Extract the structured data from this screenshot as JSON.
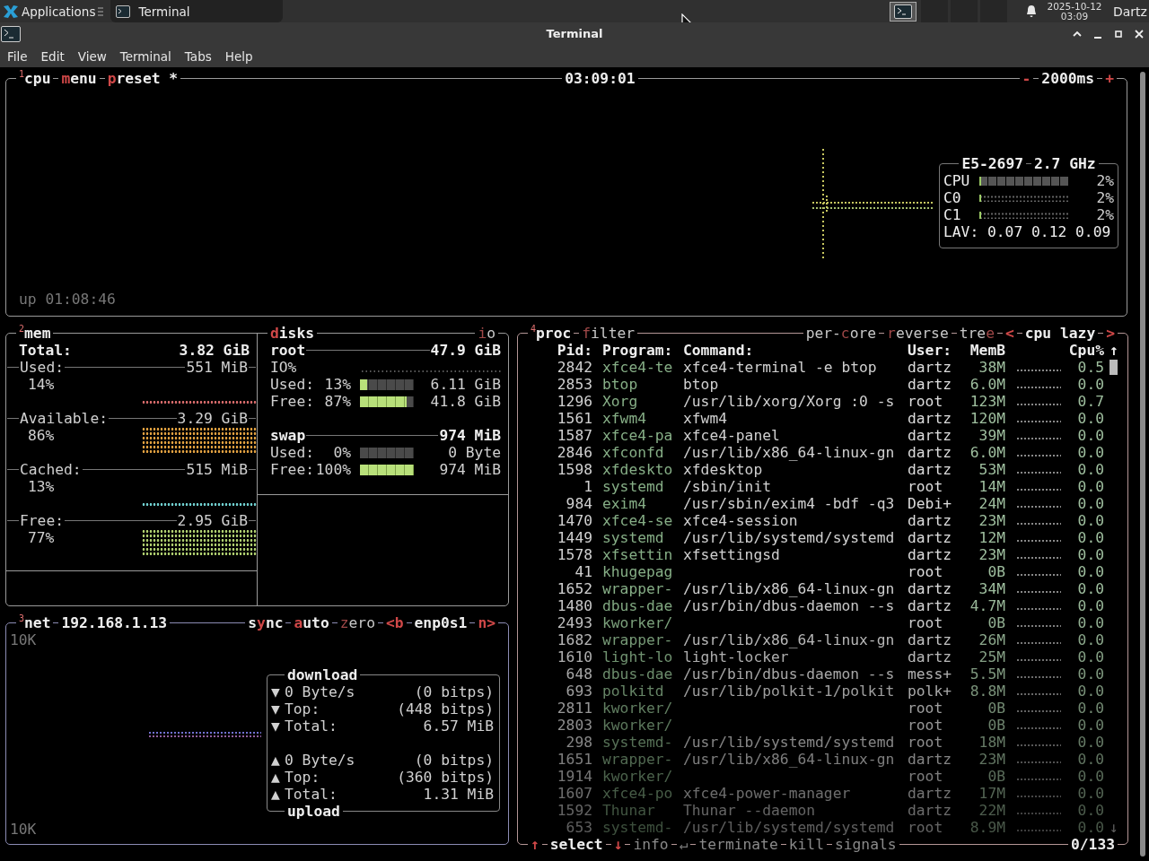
{
  "taskbar": {
    "apps_label": "Applications",
    "window_button": "Terminal",
    "date": "2025-10-12",
    "time": "03:09",
    "user": "Dartz"
  },
  "window": {
    "title": "Terminal"
  },
  "menu": [
    "File",
    "Edit",
    "View",
    "Terminal",
    "Tabs",
    "Help"
  ],
  "cpu": {
    "header": {
      "left": [
        {
          "kind": "title",
          "text": "$^{1}$cpu"
        },
        {
          "kind": "button",
          "key": "m",
          "after": "enu",
          "on": true
        },
        {
          "kind": "button",
          "key": "p",
          "after": "reset *",
          "on": true
        }
      ],
      "center": [
        {
          "kind": "label",
          "text": "03:09:01",
          "on": true
        }
      ],
      "right": [
        {
          "kind": "key",
          "text": "-",
          "on": true
        },
        {
          "kind": "label",
          "text": "2000ms",
          "on": true
        },
        {
          "kind": "key",
          "text": "+",
          "on": true
        }
      ]
    },
    "info": {
      "model": "E5-2697",
      "freq": "2.7 GHz",
      "rows": [
        {
          "label": "CPU",
          "kind": "blocks",
          "level": 0.02,
          "reading": "2%"
        },
        {
          "label": "C0",
          "kind": "dots",
          "level": 0.02,
          "reading": "2%"
        },
        {
          "label": "C1",
          "kind": "dots",
          "level": 0.02,
          "reading": "2%"
        }
      ],
      "load": "LAV: 0.07 0.12 0.09"
    },
    "uptime": "up 01:08:46"
  },
  "mem": {
    "header": {
      "left": [
        {
          "kind": "title",
          "text": "$^{2}$mem"
        }
      ]
    },
    "items": [
      {
        "kind": "total",
        "label": "Total:",
        "value": "3.82 GiB"
      },
      {
        "kind": "line",
        "label": "Used:",
        "value": "551 MiB",
        "percent": "14%",
        "color": "#d46a6a"
      },
      {
        "kind": "block",
        "label": "Available:",
        "value": "3.29 GiB",
        "percent": "86%",
        "color": "#e0a040"
      },
      {
        "kind": "line",
        "label": "Cached:",
        "value": "515 MiB",
        "percent": "13%",
        "color": "#70d0d0"
      },
      {
        "kind": "block",
        "label": "Free:",
        "value": "2.95 GiB",
        "percent": "77%",
        "color": "#b0d070"
      }
    ]
  },
  "disks": {
    "header": {
      "left": [
        {
          "kind": "button",
          "key": "d",
          "after": "isks",
          "on": true
        }
      ],
      "right": [
        {
          "kind": "button",
          "key": "i",
          "after": "o",
          "on": false
        }
      ]
    },
    "items": [
      {
        "name": "root",
        "size": "47.9 GiB",
        "io_label": "IO%",
        "rows": [
          {
            "label": "Used:",
            "percent": "13%",
            "level": 0.13,
            "value": "6.11 GiB"
          },
          {
            "label": "Free:",
            "percent": "87%",
            "level": 0.87,
            "value": "41.8 GiB"
          }
        ]
      },
      {
        "name": "swap",
        "size": "974 MiB",
        "rows": [
          {
            "label": "Used:",
            "percent": "0%",
            "level": 0,
            "value": "0 Byte"
          },
          {
            "label": "Free:",
            "percent": "100%",
            "level": 1,
            "value": "974 MiB"
          }
        ]
      }
    ]
  },
  "net": {
    "header": {
      "left": [
        {
          "kind": "title",
          "text": "$^{3}$net"
        },
        {
          "kind": "label",
          "text": "192.168.1.13",
          "on": true
        }
      ],
      "right": [
        {
          "kind": "button",
          "before": "s",
          "key": "y",
          "after": "nc",
          "on": true
        },
        {
          "kind": "button",
          "key": "a",
          "after": "uto",
          "on": true
        },
        {
          "kind": "button",
          "key": "z",
          "after": "ero",
          "on": false
        },
        {
          "kind": "key",
          "text": "<b",
          "on": true
        },
        {
          "kind": "label",
          "text": "enp0s1",
          "on": true
        },
        {
          "kind": "key",
          "text": "n>",
          "on": true
        }
      ]
    },
    "scale_top": "10K",
    "scale_bottom": "10K",
    "download": {
      "title": "download",
      "rows": [
        {
          "arrow": "▼",
          "label": "0 Byte/s",
          "value": "(0 bitps)"
        },
        {
          "arrow": "▼",
          "label": "Top:",
          "value": "(448 bitps)"
        },
        {
          "arrow": "▼",
          "label": "Total:",
          "value": "6.57 MiB"
        }
      ]
    },
    "upload": {
      "title": "upload",
      "rows": [
        {
          "arrow": "▲",
          "label": "0 Byte/s",
          "value": "(0 bitps)"
        },
        {
          "arrow": "▲",
          "label": "Top:",
          "value": "(360 bitps)"
        },
        {
          "arrow": "▲",
          "label": "Total:",
          "value": "1.31 MiB"
        }
      ]
    }
  },
  "proc": {
    "header": {
      "left": [
        {
          "kind": "title",
          "text": "$^{4}$proc"
        },
        {
          "kind": "button",
          "key": "f",
          "after": "ilter",
          "on": false
        }
      ],
      "right": [
        {
          "kind": "button",
          "before": "per-",
          "key": "c",
          "after": "ore",
          "on": false
        },
        {
          "kind": "button",
          "key": "r",
          "after": "everse",
          "on": false
        },
        {
          "kind": "button",
          "before": "tre",
          "key": "e",
          "on": false
        },
        {
          "kind": "key",
          "text": "<",
          "on": true
        },
        {
          "kind": "label",
          "text": "cpu lazy",
          "on": true
        },
        {
          "kind": "key",
          "text": ">",
          "on": true
        }
      ]
    },
    "columns": [
      "Pid:",
      "Program:",
      "Command:",
      "User:",
      "MemB",
      "Cpu%"
    ],
    "scroll": {
      "up": "↑",
      "down": "↓"
    },
    "rows": [
      {
        "pid": "2842",
        "program": "xfce4-te",
        "command": "xfce4-terminal -e btop",
        "user": "dartz",
        "mem": "38M",
        "cpu": "0.5"
      },
      {
        "pid": "2853",
        "program": "btop",
        "command": "btop",
        "user": "dartz",
        "mem": "6.0M",
        "cpu": "0.0"
      },
      {
        "pid": "1296",
        "program": "Xorg",
        "command": "/usr/lib/xorg/Xorg :0 -s",
        "user": "root",
        "mem": "123M",
        "cpu": "0.7"
      },
      {
        "pid": "1561",
        "program": "xfwm4",
        "command": "xfwm4",
        "user": "dartz",
        "mem": "120M",
        "cpu": "0.0"
      },
      {
        "pid": "1587",
        "program": "xfce4-pa",
        "command": "xfce4-panel",
        "user": "dartz",
        "mem": "39M",
        "cpu": "0.0"
      },
      {
        "pid": "2846",
        "program": "xfconfd",
        "command": "/usr/lib/x86_64-linux-gn",
        "user": "dartz",
        "mem": "6.0M",
        "cpu": "0.0"
      },
      {
        "pid": "1598",
        "program": "xfdeskto",
        "command": "xfdesktop",
        "user": "dartz",
        "mem": "53M",
        "cpu": "0.0"
      },
      {
        "pid": "1",
        "program": "systemd",
        "command": "/sbin/init",
        "user": "root",
        "mem": "14M",
        "cpu": "0.0"
      },
      {
        "pid": "984",
        "program": "exim4",
        "command": "/usr/sbin/exim4 -bdf -q3",
        "user": "Debi+",
        "mem": "24M",
        "cpu": "0.0"
      },
      {
        "pid": "1470",
        "program": "xfce4-se",
        "command": "xfce4-session",
        "user": "dartz",
        "mem": "23M",
        "cpu": "0.0"
      },
      {
        "pid": "1449",
        "program": "systemd",
        "command": "/usr/lib/systemd/systemd",
        "user": "dartz",
        "mem": "12M",
        "cpu": "0.0"
      },
      {
        "pid": "1578",
        "program": "xfsettin",
        "command": "xfsettingsd",
        "user": "dartz",
        "mem": "23M",
        "cpu": "0.0"
      },
      {
        "pid": "41",
        "program": "khugepag",
        "user": "root",
        "mem": "0B",
        "cpu": "0.0"
      },
      {
        "pid": "1652",
        "program": "wrapper-",
        "command": "/usr/lib/x86_64-linux-gn",
        "user": "dartz",
        "mem": "34M",
        "cpu": "0.0"
      },
      {
        "pid": "1480",
        "program": "dbus-dae",
        "command": "/usr/bin/dbus-daemon --s",
        "user": "dartz",
        "mem": "4.7M",
        "cpu": "0.0"
      },
      {
        "pid": "2493",
        "program": "kworker/",
        "user": "root",
        "mem": "0B",
        "cpu": "0.0"
      },
      {
        "pid": "1682",
        "program": "wrapper-",
        "command": "/usr/lib/x86_64-linux-gn",
        "user": "dartz",
        "mem": "26M",
        "cpu": "0.0"
      },
      {
        "pid": "1610",
        "program": "light-lo",
        "command": "light-locker",
        "user": "dartz",
        "mem": "25M",
        "cpu": "0.0"
      },
      {
        "pid": "648",
        "program": "dbus-dae",
        "command": "/usr/bin/dbus-daemon --s",
        "user": "mess+",
        "mem": "5.5M",
        "cpu": "0.0"
      },
      {
        "pid": "693",
        "program": "polkitd",
        "command": "/usr/lib/polkit-1/polkit",
        "user": "polk+",
        "mem": "8.8M",
        "cpu": "0.0"
      },
      {
        "pid": "2811",
        "program": "kworker/",
        "user": "root",
        "mem": "0B",
        "cpu": "0.0"
      },
      {
        "pid": "2803",
        "program": "kworker/",
        "user": "root",
        "mem": "0B",
        "cpu": "0.0"
      },
      {
        "pid": "298",
        "program": "systemd-",
        "command": "/usr/lib/systemd/systemd",
        "user": "root",
        "mem": "18M",
        "cpu": "0.0"
      },
      {
        "pid": "1651",
        "program": "wrapper-",
        "command": "/usr/lib/x86_64-linux-gn",
        "user": "dartz",
        "mem": "23M",
        "cpu": "0.0"
      },
      {
        "pid": "1914",
        "program": "kworker/",
        "user": "root",
        "mem": "0B",
        "cpu": "0.0"
      },
      {
        "pid": "1607",
        "program": "xfce4-po",
        "command": "xfce4-power-manager",
        "user": "dartz",
        "mem": "17M",
        "cpu": "0.0"
      },
      {
        "pid": "1592",
        "program": "Thunar",
        "command": "Thunar --daemon",
        "user": "dartz",
        "mem": "22M",
        "cpu": "0.0"
      },
      {
        "pid": "653",
        "program": "systemd-",
        "command": "/usr/lib/systemd/systemd",
        "user": "root",
        "mem": "8.9M",
        "cpu": "0.0"
      }
    ],
    "footer": {
      "left": [
        {
          "kind": "key",
          "text": "↑",
          "on": true
        },
        {
          "kind": "label",
          "text": "select",
          "on": true
        },
        {
          "kind": "key",
          "text": "↓",
          "on": true
        },
        {
          "kind": "label",
          "text": "info",
          "on": false
        },
        {
          "kind": "key",
          "text": "↵",
          "on": false
        },
        {
          "kind": "label",
          "text": "terminate",
          "on": false
        },
        {
          "kind": "label",
          "text": "kill",
          "on": false
        },
        {
          "kind": "label",
          "text": "signals",
          "on": false
        }
      ],
      "right": [
        {
          "kind": "label",
          "text": "0/133",
          "on": true
        }
      ]
    }
  }
}
